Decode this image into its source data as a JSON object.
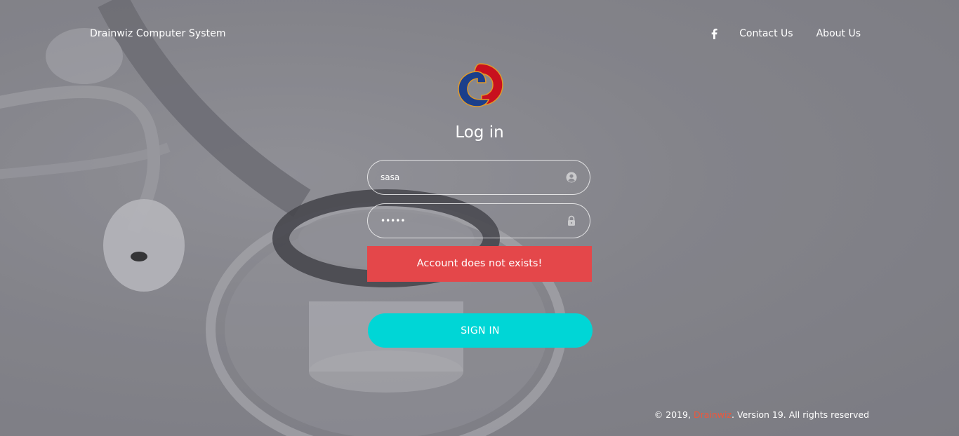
{
  "header": {
    "brand": "Drainwiz Computer System",
    "nav": {
      "facebook_icon": "facebook-icon",
      "contact_label": "Contact Us",
      "about_label": "About Us"
    }
  },
  "login": {
    "logo_icon": "drainwiz-logo",
    "title": "Log in",
    "username": {
      "value": "sasa",
      "icon": "user-circle-icon"
    },
    "password": {
      "value": "•••••",
      "icon": "lock-icon"
    },
    "error_message": "Account does not exists!",
    "submit_label": "SIGN IN"
  },
  "footer": {
    "prefix": "© 2019, ",
    "link_text": "Drainwiz",
    "suffix": ". Version 19. All rights reserved"
  },
  "colors": {
    "accent": "#00d6d6",
    "error": "#e4474a",
    "footer_link": "#f0563a"
  }
}
